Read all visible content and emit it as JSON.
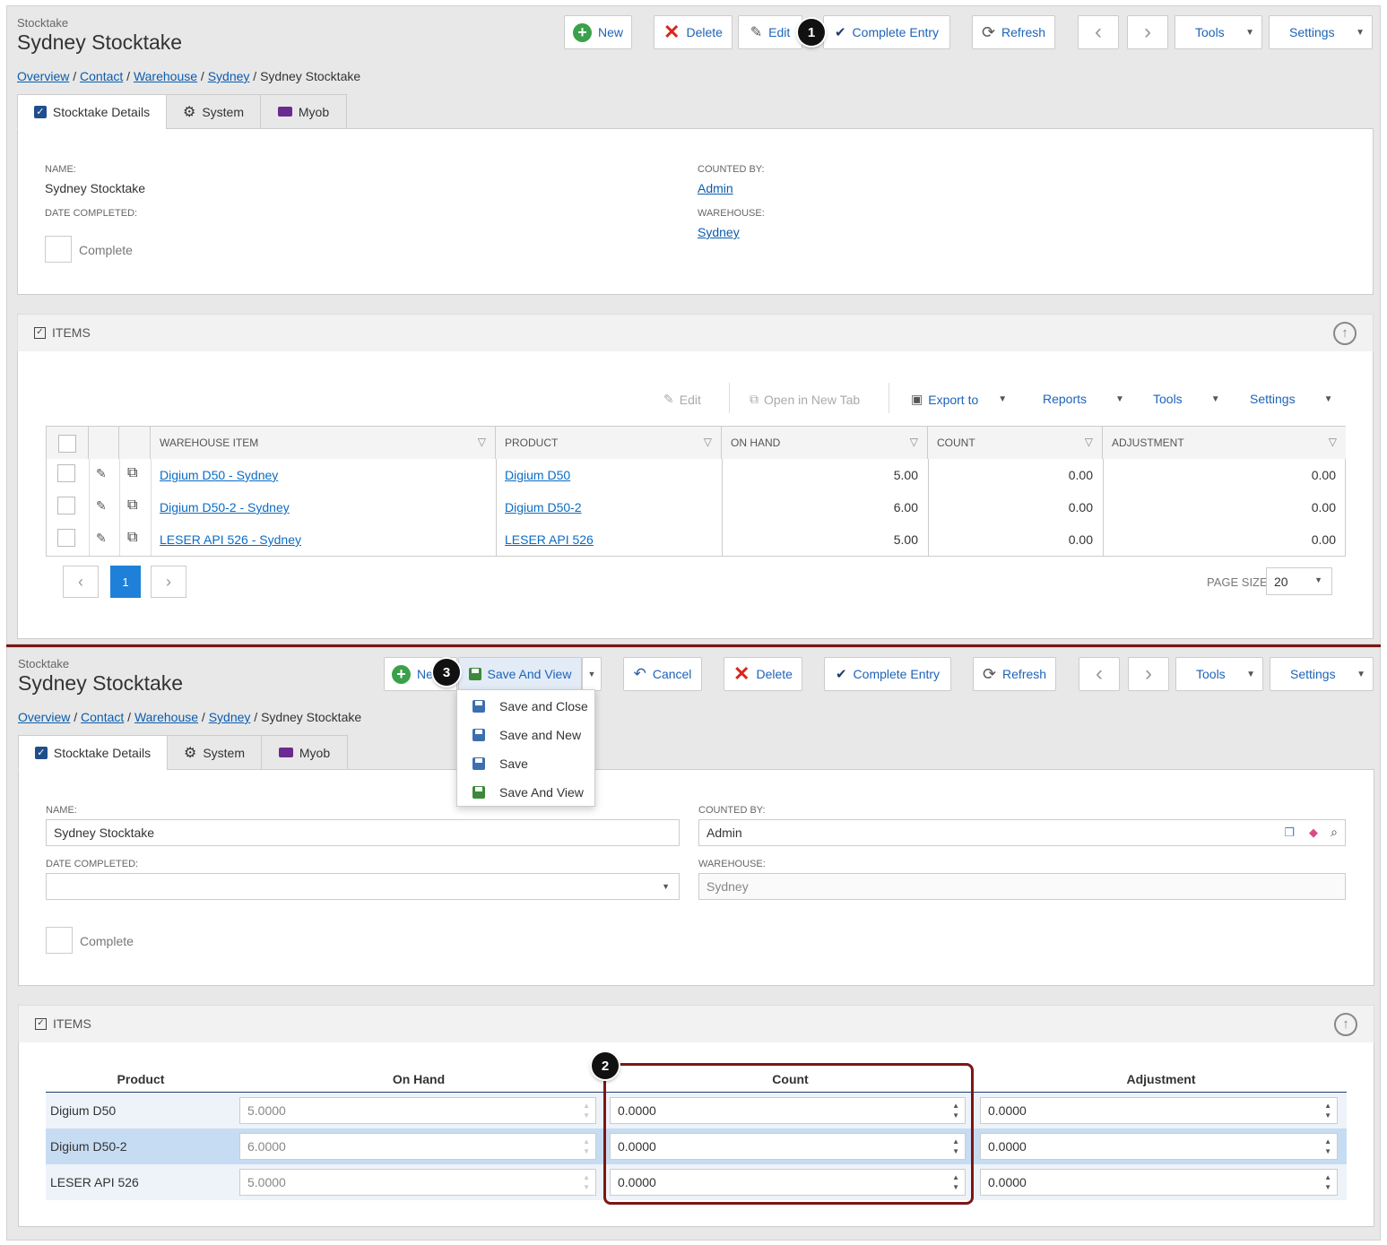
{
  "top": {
    "module": "Stocktake",
    "title": "Sydney Stocktake",
    "toolbar": {
      "new": "New",
      "delete": "Delete",
      "edit": "Edit",
      "complete_entry": "Complete Entry",
      "refresh": "Refresh",
      "tools": "Tools",
      "settings": "Settings"
    },
    "breadcrumb": [
      "Overview",
      "Contact",
      "Warehouse",
      "Sydney",
      "Sydney Stocktake"
    ],
    "tabs": [
      "Stocktake Details",
      "System",
      "Myob"
    ],
    "fields": {
      "name_label": "NAME:",
      "name_value": "Sydney Stocktake",
      "date_label": "DATE COMPLETED:",
      "complete_label": "Complete",
      "counted_by_label": "COUNTED BY:",
      "counted_by_value": "Admin",
      "warehouse_label": "WAREHOUSE:",
      "warehouse_value": "Sydney"
    },
    "items": {
      "title": "ITEMS",
      "toolbar": {
        "edit": "Edit",
        "open_new_tab": "Open in New Tab",
        "export": "Export to",
        "reports": "Reports",
        "tools": "Tools",
        "settings": "Settings"
      },
      "columns": [
        "WAREHOUSE ITEM",
        "PRODUCT",
        "ON HAND",
        "COUNT",
        "ADJUSTMENT"
      ],
      "rows": [
        {
          "warehouse_item": "Digium D50 - Sydney",
          "product": "Digium D50",
          "on_hand": "5.00",
          "count": "0.00",
          "adjustment": "0.00"
        },
        {
          "warehouse_item": "Digium D50-2 - Sydney",
          "product": "Digium D50-2",
          "on_hand": "6.00",
          "count": "0.00",
          "adjustment": "0.00"
        },
        {
          "warehouse_item": "LESER API 526 - Sydney",
          "product": "LESER API 526",
          "on_hand": "5.00",
          "count": "0.00",
          "adjustment": "0.00"
        }
      ],
      "page": "1",
      "page_size_label": "PAGE SIZE",
      "page_size": "20"
    }
  },
  "bottom": {
    "module": "Stocktake",
    "title": "Sydney Stocktake",
    "toolbar": {
      "new": "Ne",
      "save_and_view": "Save And View",
      "cancel": "Cancel",
      "delete": "Delete",
      "complete_entry": "Complete Entry",
      "refresh": "Refresh",
      "tools": "Tools",
      "settings": "Settings"
    },
    "save_menu": [
      "Save and Close",
      "Save and New",
      "Save",
      "Save And View"
    ],
    "breadcrumb": [
      "Overview",
      "Contact",
      "Warehouse",
      "Sydney",
      "Sydney Stocktake"
    ],
    "tabs": [
      "Stocktake Details",
      "System",
      "Myob"
    ],
    "fields": {
      "name_label": "NAME:",
      "name_value": "Sydney Stocktake",
      "date_label": "DATE COMPLETED:",
      "complete_label": "Complete",
      "counted_by_label": "COUNTED BY:",
      "counted_by_value": "Admin",
      "warehouse_label": "WAREHOUSE:",
      "warehouse_value": "Sydney"
    },
    "items": {
      "title": "ITEMS",
      "columns": [
        "Product",
        "On Hand",
        "Count",
        "Adjustment"
      ],
      "rows": [
        {
          "product": "Digium D50",
          "on_hand": "5.0000",
          "count": "0.0000",
          "adjustment": "0.0000"
        },
        {
          "product": "Digium D50-2",
          "on_hand": "6.0000",
          "count": "0.0000",
          "adjustment": "0.0000"
        },
        {
          "product": "LESER API 526",
          "on_hand": "5.0000",
          "count": "0.0000",
          "adjustment": "0.0000"
        }
      ]
    }
  },
  "annotations": [
    "1",
    "2",
    "3"
  ],
  "colors": {
    "link": "#0b5cad",
    "accent": "#1e80d8",
    "highlight": "#7d1616",
    "delete": "#d9261c",
    "new": "#3aa14a"
  }
}
